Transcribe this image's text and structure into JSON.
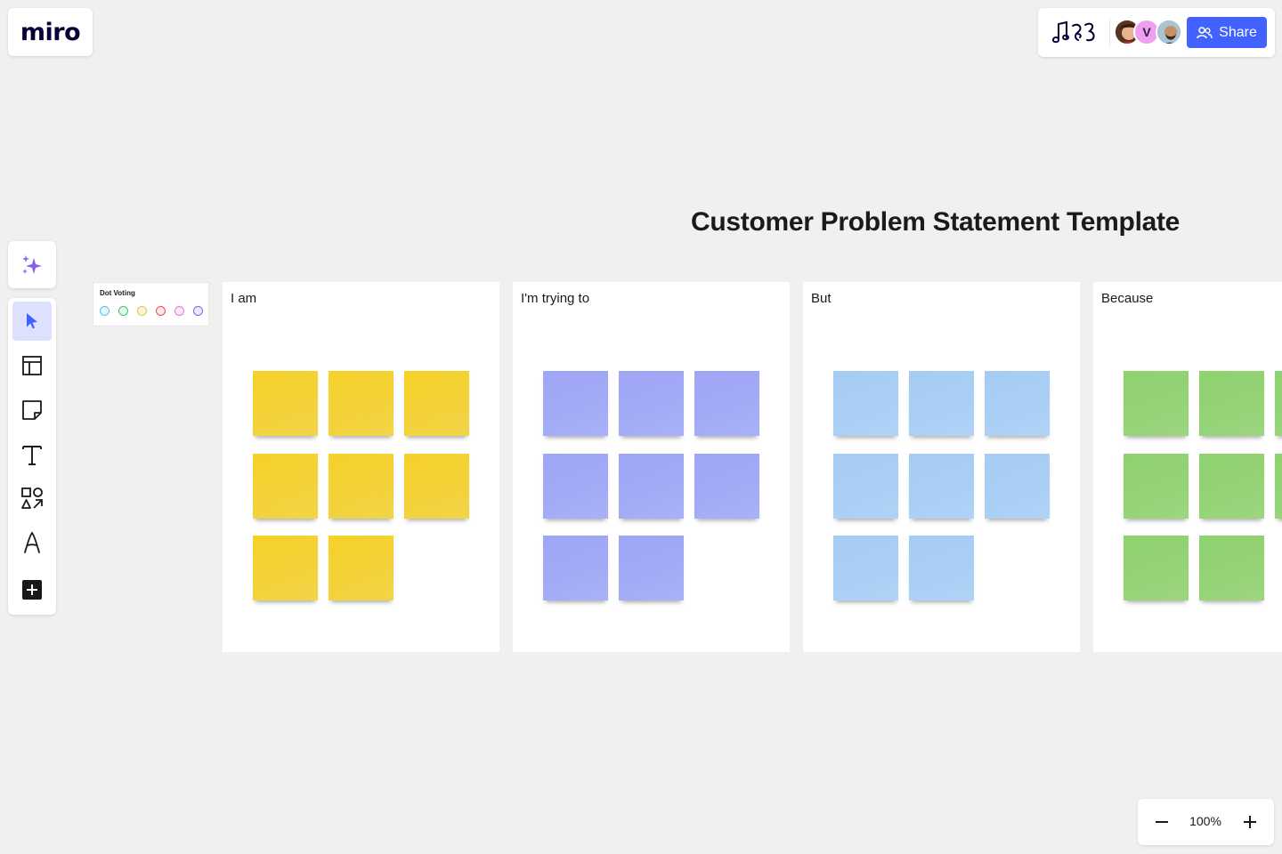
{
  "app": {
    "logo_text": "miro"
  },
  "header": {
    "share_label": "Share",
    "collaborators": [
      {
        "type": "photo",
        "name": "user-1"
      },
      {
        "type": "initial",
        "initial": "V",
        "color": "#ee9ff0"
      },
      {
        "type": "photo",
        "name": "user-3"
      }
    ],
    "accent_color": "#4262ff"
  },
  "toolbar": {
    "ai_tool": "sparkle-icon",
    "tools": [
      {
        "name": "select",
        "icon": "cursor-icon",
        "active": true
      },
      {
        "name": "templates",
        "icon": "layout-icon",
        "active": false
      },
      {
        "name": "sticky-note",
        "icon": "sticky-note-icon",
        "active": false
      },
      {
        "name": "text",
        "icon": "text-icon",
        "active": false
      },
      {
        "name": "shapes",
        "icon": "shapes-icon",
        "active": false
      },
      {
        "name": "pen",
        "icon": "pen-icon",
        "active": false
      },
      {
        "name": "more",
        "icon": "plus-icon",
        "active": false
      }
    ]
  },
  "board": {
    "title": "Customer Problem Statement Template",
    "dot_voting": {
      "title": "Dot Voting",
      "dots": [
        "#4fc3e8",
        "#3ec46d",
        "#e8c335",
        "#e8505b",
        "#e07ad8",
        "#6a6fe8"
      ]
    },
    "frames": [
      {
        "label": "I am",
        "color": "yellow",
        "sticky_count": 8
      },
      {
        "label": "I'm trying to",
        "color": "purple",
        "sticky_count": 8
      },
      {
        "label": "But",
        "color": "blue",
        "sticky_count": 8
      },
      {
        "label": "Because",
        "color": "green",
        "sticky_count": 8
      }
    ]
  },
  "zoom": {
    "level": "100%"
  }
}
